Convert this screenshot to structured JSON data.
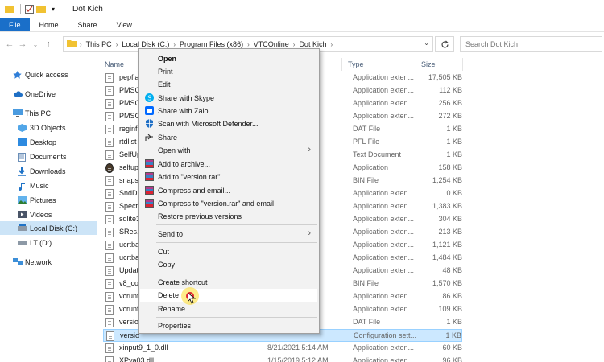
{
  "window": {
    "title": "Dot Kich"
  },
  "ribbon": {
    "tabs": [
      "File",
      "Home",
      "Share",
      "View"
    ]
  },
  "address": {
    "crumbs": [
      "This PC",
      "Local Disk (C:)",
      "Program Files (x86)",
      "VTCOnline",
      "Dot Kich"
    ],
    "search_placeholder": "Search Dot Kich"
  },
  "sidebar": {
    "items": [
      {
        "label": "Quick access",
        "icon": "star-icon"
      },
      {
        "label": "OneDrive",
        "icon": "cloud-icon"
      },
      {
        "label": "This PC",
        "icon": "computer-icon"
      },
      {
        "label": "3D Objects",
        "icon": "cube-icon"
      },
      {
        "label": "Desktop",
        "icon": "desktop-icon"
      },
      {
        "label": "Documents",
        "icon": "documents-icon"
      },
      {
        "label": "Downloads",
        "icon": "download-icon"
      },
      {
        "label": "Music",
        "icon": "music-icon"
      },
      {
        "label": "Pictures",
        "icon": "pictures-icon"
      },
      {
        "label": "Videos",
        "icon": "videos-icon"
      },
      {
        "label": "Local Disk (C:)",
        "icon": "drive-icon"
      },
      {
        "label": "LT (D:)",
        "icon": "drive-icon"
      },
      {
        "label": "Network",
        "icon": "network-icon"
      }
    ]
  },
  "columns": {
    "name": "Name",
    "type": "Type",
    "size": "Size"
  },
  "files": [
    {
      "name": "pepfla",
      "date": "",
      "type": "Application exten...",
      "size": "17,505 KB"
    },
    {
      "name": "PMSC",
      "date": "",
      "type": "Application exten...",
      "size": "112 KB"
    },
    {
      "name": "PMSC",
      "date": "",
      "type": "Application exten...",
      "size": "256 KB"
    },
    {
      "name": "PMSC",
      "date": "",
      "type": "Application exten...",
      "size": "272 KB"
    },
    {
      "name": "reginf",
      "date": "",
      "type": "DAT File",
      "size": "1 KB"
    },
    {
      "name": "rtdlist",
      "date": "",
      "type": "PFL File",
      "size": "1 KB"
    },
    {
      "name": "SelfUp",
      "date": "",
      "type": "Text Document",
      "size": "1 KB"
    },
    {
      "name": "selfup",
      "date": "",
      "type": "Application",
      "size": "158 KB"
    },
    {
      "name": "snapsl",
      "date": "",
      "type": "BIN File",
      "size": "1,254 KB"
    },
    {
      "name": "SndDr",
      "date": "",
      "type": "Application exten...",
      "size": "0 KB"
    },
    {
      "name": "Specta",
      "date": "",
      "type": "Application exten...",
      "size": "1,383 KB"
    },
    {
      "name": "sqlite3",
      "date": "M",
      "type": "Application exten...",
      "size": "304 KB"
    },
    {
      "name": "SRes.c",
      "date": "M",
      "type": "Application exten...",
      "size": "213 KB"
    },
    {
      "name": "ucrtba",
      "date": "M",
      "type": "Application exten...",
      "size": "1,121 KB"
    },
    {
      "name": "ucrtba",
      "date": "M",
      "type": "Application exten...",
      "size": "1,484 KB"
    },
    {
      "name": "Updat",
      "date": "",
      "type": "Application exten...",
      "size": "48 KB"
    },
    {
      "name": "v8_coi",
      "date": "",
      "type": "BIN File",
      "size": "1,570 KB"
    },
    {
      "name": "vcrunt",
      "date": "M",
      "type": "Application exten...",
      "size": "86 KB"
    },
    {
      "name": "vcrunt",
      "date": "M",
      "type": "Application exten...",
      "size": "109 KB"
    },
    {
      "name": "versio",
      "date": "",
      "type": "DAT File",
      "size": "1 KB"
    },
    {
      "name": "versio",
      "date": "",
      "type": "Configuration sett...",
      "size": "1 KB"
    },
    {
      "name": "xinput9_1_0.dll",
      "date": "8/21/2021 5:14 AM",
      "type": "Application exten...",
      "size": "60 KB"
    },
    {
      "name": "XPva03.dll",
      "date": "1/15/2019 5:12 AM",
      "type": "Application exten...",
      "size": "96 KB"
    }
  ],
  "context_menu": {
    "items": [
      "Open",
      "Print",
      "Edit",
      "Share with Skype",
      "Share with Zalo",
      "Scan with Microsoft Defender...",
      "Share",
      "Open with",
      "Add to archive...",
      "Add to \"version.rar\"",
      "Compress and email...",
      "Compress to \"version.rar\" and email",
      "Restore previous versions",
      "Send to",
      "Cut",
      "Copy",
      "Create shortcut",
      "Delete",
      "Rename",
      "Properties"
    ]
  }
}
